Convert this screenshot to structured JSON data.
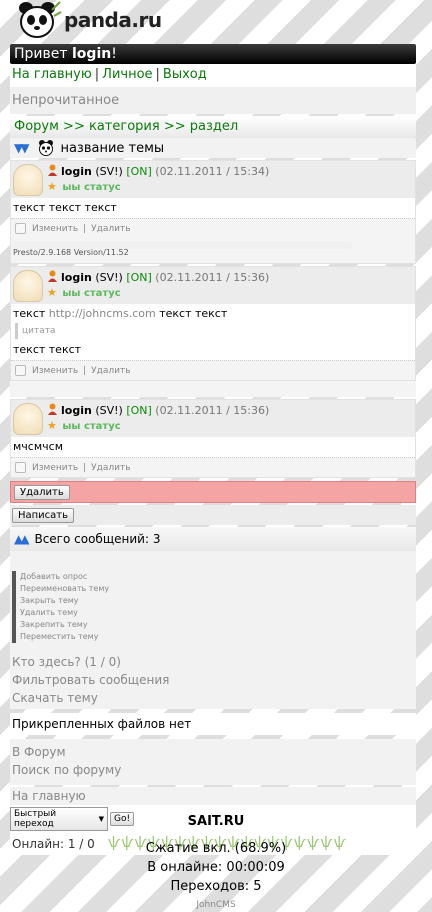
{
  "logo": {
    "brand": "panda.ru"
  },
  "header": {
    "greeting": "Привет",
    "username": "login",
    "bang": "!"
  },
  "menu": [
    {
      "label": "На главную"
    },
    {
      "label": "Личное"
    },
    {
      "label": "Выход"
    }
  ],
  "unread": "Непрочитанное",
  "breadcrumb": {
    "forum": "Форум",
    "sep1": ">>",
    "category": "категория",
    "sep2": ">>",
    "section": "раздел"
  },
  "topic": {
    "title": "название темы"
  },
  "posts": [
    {
      "user": "login",
      "tag": "(SV!)",
      "online": "[ON]",
      "date": "(02.11.2011 / 15:34)",
      "status": "ыы статус",
      "text": "текст текст текст",
      "edit": "Изменить",
      "delete": "Удалить",
      "ua": "Presto/2.9.168 Version/11.52"
    },
    {
      "user": "login",
      "tag": "(SV!)",
      "online": "[ON]",
      "date": "(02.11.2011 / 15:36)",
      "status": "ыы статус",
      "text_before": "текст",
      "link": "http://johncms.com",
      "text_after": "текст текст",
      "quote": "цитата",
      "text2": "текст текст",
      "edit": "Изменить",
      "delete": "Удалить"
    },
    {
      "user": "login",
      "tag": "(SV!)",
      "online": "[ON]",
      "date": "(02.11.2011 / 15:36)",
      "status": "ыы статус",
      "text": "мчсмчсм",
      "edit": "Изменить",
      "delete": "Удалить"
    }
  ],
  "actions": {
    "delete_btn": "Удалить",
    "write_btn": "Написать"
  },
  "total": {
    "label": "Всего сообщений:",
    "count": "3"
  },
  "tools": [
    "Добавить опрос",
    "Переименовать тему",
    "Закрыть тему",
    "Удалить тему",
    "Закрепить тему",
    "Переместить тему"
  ],
  "links": {
    "who": "Кто здесь? (1 / 0)",
    "filter": "Фильтровать сообщения",
    "download": "Скачать тему"
  },
  "nofiles": "Прикрепленных файлов нет",
  "links2": {
    "to_forum": "В Форум",
    "search": "Поиск по форуму"
  },
  "home": "На главную",
  "jump": {
    "select": "Быстрый переход",
    "go": "Go!"
  },
  "online": "Онлайн: 1 / 0",
  "footer": {
    "site": "SAIT.RU",
    "compress": "Сжатие вкл. (68.9%)",
    "online_time": "В онлайне: 00:00:09",
    "transitions": "Переходов: 5",
    "author": "JohnCMS"
  },
  "colors": {
    "accent": "#0a7a0a",
    "status": "#5cb85c",
    "delete_bar": "#f4a4a4",
    "header_bg": "#000000"
  }
}
